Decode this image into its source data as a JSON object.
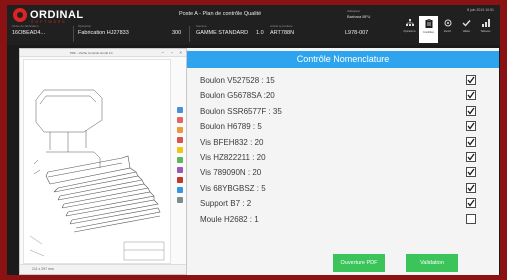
{
  "app": {
    "brand": "ORDINAL",
    "brand_sub": "SOFTWARE",
    "station": "Poste A - Plan de contrôle Qualité",
    "user_label": "Utilisateur",
    "user_name": "Barbara BFU",
    "clock": "8 juin 2019 10:51"
  },
  "info": {
    "order_label": "Ordre de fabrication",
    "order_value": "16OBEAD4...",
    "op_label": "Opération",
    "op_value": "Fabrication HJ27833",
    "qty_value": "300",
    "gamme_label": "Gamme",
    "gamme_value": "GAMME STANDARD",
    "version_value": "1.0",
    "article_label": "Article à produire",
    "article_value": "ART788N",
    "ref_value": "L978-007"
  },
  "toolbar": [
    {
      "icon": "hierarchy-icon",
      "label": "Opérations"
    },
    {
      "icon": "clipboard-icon",
      "label": "Contrôles"
    },
    {
      "icon": "scan-icon",
      "label": "Identif."
    },
    {
      "icon": "check-icon",
      "label": "Valider"
    },
    {
      "icon": "chart-icon",
      "label": "Tableaux"
    }
  ],
  "pdf": {
    "title": "PDF - Vérifie Contrôle Nomb 1C",
    "status": "211 x 297 mm"
  },
  "panel": {
    "title": "Contrôle Nomenclature",
    "items": [
      {
        "label": "Boulon V527528 : 15",
        "checked": true
      },
      {
        "label": "Boulon G5678SA :20",
        "checked": true
      },
      {
        "label": "Boulon SSR6577F : 35",
        "checked": true
      },
      {
        "label": "Boulon H6789 : 5",
        "checked": true
      },
      {
        "label": "Vis BFEH832 : 20",
        "checked": true
      },
      {
        "label": "Vis HZ822211 : 20",
        "checked": true
      },
      {
        "label": "Vis 789090N : 20",
        "checked": true
      },
      {
        "label": "Vis 68YBGBSZ : 5",
        "checked": true
      },
      {
        "label": "Support B7 : 2",
        "checked": true
      },
      {
        "label": "Moule H2682 : 1",
        "checked": false
      }
    ],
    "open_pdf_label": "Ouverture PDF",
    "validate_label": "Validation"
  },
  "colors": {
    "accent_blue": "#2ea3ee",
    "button_green": "#3bc45a",
    "brand_red": "#e02222",
    "border_red": "#8a1212"
  }
}
